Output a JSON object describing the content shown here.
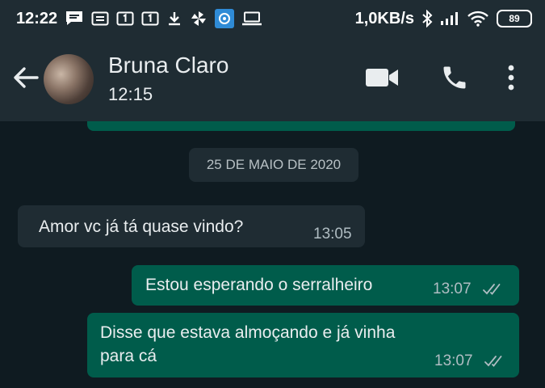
{
  "status_bar": {
    "time": "12:22",
    "speed": "1,0KB/s",
    "battery": "89",
    "left_icons": [
      "message-icon",
      "notification-box-icon",
      "sim1-icon",
      "sim1-icon",
      "download-icon",
      "pinwheel-icon",
      "vpn-icon",
      "laptop-icon"
    ],
    "right_icons": [
      "bluetooth-icon",
      "signal-icon",
      "wifi-icon",
      "battery-icon"
    ]
  },
  "header": {
    "contact_name": "Bruna Claro",
    "subtitle": "12:15",
    "icons": [
      "back-arrow-icon",
      "video-call-icon",
      "voice-call-icon",
      "more-vertical-icon"
    ]
  },
  "chat": {
    "date_divider": "25 DE MAIO DE 2020",
    "messages": [
      {
        "direction": "incoming",
        "text": "Amor vc já tá quase vindo?",
        "time": "13:05"
      },
      {
        "direction": "outgoing",
        "text": "Estou esperando o serralheiro",
        "time": "13:07",
        "status": "read"
      },
      {
        "direction": "outgoing",
        "text_line1": "Disse que estava almoçando e já vinha",
        "text_line2": "para cá",
        "time": "13:07",
        "status": "read"
      }
    ]
  },
  "colors": {
    "background": "#0f1b21",
    "bar": "#1f2c33",
    "outgoing_bubble": "#005c4b",
    "incoming_bubble": "#1f2c33",
    "text": "#e9edef",
    "meta_text": "#b0bdc3"
  }
}
